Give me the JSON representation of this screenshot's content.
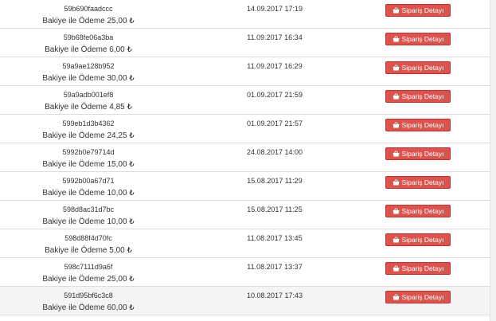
{
  "orders": {
    "button_label": "Sipariş Detayı",
    "rows": [
      {
        "id": "59b690faadccc",
        "description": "Bakiye ile Ödeme 25,00 ₺",
        "date": "14.09.2017 17:19"
      },
      {
        "id": "59b68fe06a3ba",
        "description": "Bakiye ile Ödeme 6,00 ₺",
        "date": "11.09.2017 16:34"
      },
      {
        "id": "59a9ae128b952",
        "description": "Bakiye ile Ödeme 30,00 ₺",
        "date": "11.09.2017 16:29"
      },
      {
        "id": "59a9adb001ef8",
        "description": "Bakiye ile Ödeme 4,85 ₺",
        "date": "01.09.2017 21:59"
      },
      {
        "id": "599eb1d3b4362",
        "description": "Bakiye ile Ödeme 24,25 ₺",
        "date": "01.09.2017 21:57"
      },
      {
        "id": "5992b0e79714d",
        "description": "Bakiye ile Ödeme 15,00 ₺",
        "date": "24.08.2017 14:00"
      },
      {
        "id": "5992b00a67d71",
        "description": "Bakiye ile Ödeme 10,00 ₺",
        "date": "15.08.2017 11:29"
      },
      {
        "id": "598d8ac31d7bc",
        "description": "Bakiye ile Ödeme 10,00 ₺",
        "date": "15.08.2017 11:25"
      },
      {
        "id": "598d88f4d70fc",
        "description": "Bakiye ile Ödeme 5,00 ₺",
        "date": "11.08.2017 13:45"
      },
      {
        "id": "598c7111d9a6f",
        "description": "Bakiye ile Ödeme 25,00 ₺",
        "date": "11.08.2017 13:37"
      },
      {
        "id": "591d95bf6c3c8",
        "description": "Bakiye ile Ödeme 60,00 ₺",
        "date": "10.08.2017 17:43"
      }
    ]
  },
  "colors": {
    "button_bg": "#d9534f",
    "button_border": "#c9302c",
    "row_highlight": "#f4f4f4"
  },
  "icons": {
    "button_icon": "shopping-basket-icon"
  }
}
